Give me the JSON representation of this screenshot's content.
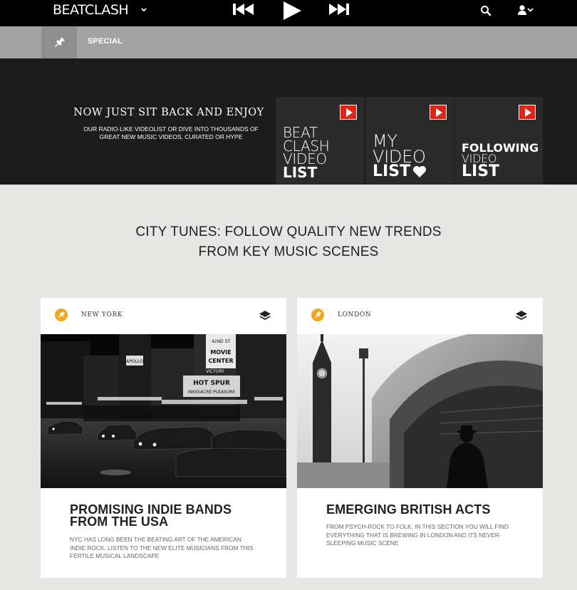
{
  "app": {
    "logo_text": "BEATCLASH"
  },
  "topbar": {
    "icons": [
      "chevron-down-icon",
      "skip-back-icon",
      "play-icon",
      "skip-forward-icon",
      "search-icon",
      "user-icon"
    ]
  },
  "subbar": {
    "label": "SPECIAL"
  },
  "hero": {
    "title": "NOW JUST SIT BACK AND ENJOY",
    "subtitle": "OUR RADIO-LIKE VIDEOLIST OR DIVE INTO THOUSANDS OF GREAT NEW MUSIC VIDEOS, CURATED OR HYPE",
    "tiles": [
      {
        "lines": [
          "BEAT",
          "CLASH",
          "VIDEO"
        ],
        "bold": "LIST"
      },
      {
        "lines": [
          "MY",
          "VIDEO"
        ],
        "bold": "LIST"
      },
      {
        "bold_top": "FOLLOWING",
        "lines": [
          "VIDEO"
        ],
        "bold": "LIST"
      }
    ]
  },
  "section": {
    "title_line1": "CITY TUNES: FOLLOW QUALITY NEW TRENDS",
    "title_line2": "FROM KEY MUSIC SCENES"
  },
  "cards": [
    {
      "city": "NEW YORK",
      "title": "PROMISING INDIE BANDS FROM THE USA",
      "description": "NYC HAS LONG BEEN THE BEATING ART OF THE AMERICAN INDIE ROCK. LISTEN TO THE NEW ELITE MUSICIANS FROM THIS FERTILE MUSICAL LANDSCAPE",
      "image_signs": {
        "apollo": "APOLLO",
        "movie": "MOVIE",
        "center": "CENTER",
        "hot_spur": "HOT SPUR",
        "victory": "VICTORY",
        "pleasure": "MASSACRE PLEASURE",
        "street": "42ND ST"
      }
    },
    {
      "city": "LONDON",
      "title": "EMERGING BRITISH ACTS",
      "description": "FROM PSYCH-ROCK TO FOLK, IN THIS SECTION YOU WILL FIND EVERYTHING THAT IS BREWING IN LONDON AND ITS NEVER-SLEEPING MUSIC SCENE"
    }
  ],
  "colors": {
    "accent_orange": "#f4a61d",
    "youtube_red": "#e22418",
    "hero_bg": "#1c1c1c",
    "subbar_bg": "#a3a3a3"
  }
}
